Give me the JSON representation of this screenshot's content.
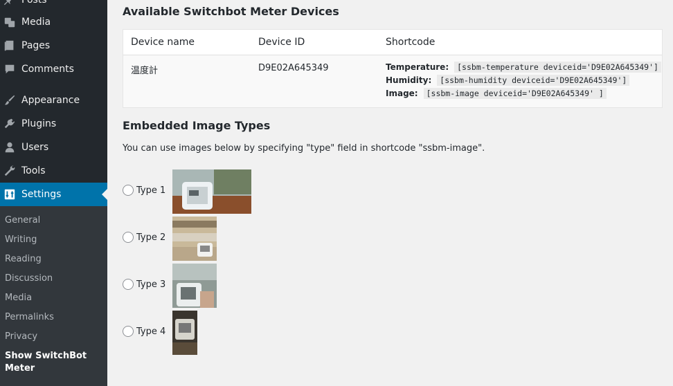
{
  "sidebar": {
    "items": [
      {
        "label": "Posts",
        "icon": "pushpin-icon"
      },
      {
        "label": "Media",
        "icon": "media-icon"
      },
      {
        "label": "Pages",
        "icon": "pages-icon"
      },
      {
        "label": "Comments",
        "icon": "comments-icon"
      },
      {
        "label": "Appearance",
        "icon": "brush-icon"
      },
      {
        "label": "Plugins",
        "icon": "plugin-icon"
      },
      {
        "label": "Users",
        "icon": "users-icon"
      },
      {
        "label": "Tools",
        "icon": "wrench-icon"
      },
      {
        "label": "Settings",
        "icon": "settings-icon"
      }
    ],
    "submenu": [
      "General",
      "Writing",
      "Reading",
      "Discussion",
      "Media",
      "Permalinks",
      "Privacy",
      "Show SwitchBot Meter"
    ]
  },
  "main": {
    "devices_heading": "Available Switchbot Meter Devices",
    "table": {
      "headers": [
        "Device name",
        "Device ID",
        "Shortcode"
      ],
      "rows": [
        {
          "name": "温度計",
          "id": "D9E02A645349",
          "shortcodes": [
            {
              "label": "Temperature:",
              "code": "[ssbm-temperature deviceid='D9E02A645349']"
            },
            {
              "label": "Humidity:",
              "code": "[ssbm-humidity deviceid='D9E02A645349']"
            },
            {
              "label": "Image:",
              "code": "[ssbm-image deviceid='D9E02A645349' ]"
            }
          ]
        }
      ]
    },
    "images_heading": "Embedded Image Types",
    "description": "You can use images below by specifying \"type\" field in shortcode \"ssbm-image\".",
    "types": [
      "Type 1",
      "Type 2",
      "Type 3",
      "Type 4"
    ]
  },
  "colors": {
    "sidebar_bg": "#23282d",
    "submenu_bg": "#32373c",
    "active": "#0073aa",
    "page_bg": "#f1f1f1"
  }
}
